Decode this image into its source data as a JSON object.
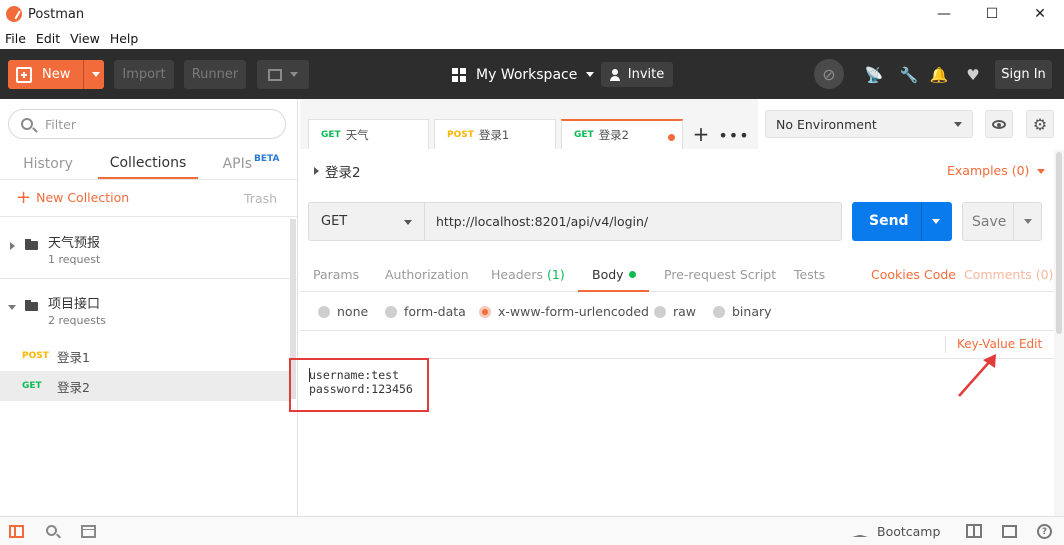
{
  "window": {
    "title": "Postman",
    "minimize_glyph": "—",
    "maximize_glyph": "☐",
    "close_glyph": "✕"
  },
  "menu": [
    "File",
    "Edit",
    "View",
    "Help"
  ],
  "header": {
    "new_label": "New",
    "import_label": "Import",
    "runner_label": "Runner",
    "workspace_label": "My Workspace",
    "invite_label": "Invite",
    "signin_label": "Sign In",
    "icons": [
      "sync-off-icon",
      "satellite-icon",
      "wrench-icon",
      "bell-icon",
      "heart-icon"
    ],
    "accent_color": "#f26b3a"
  },
  "sidebar": {
    "filter_placeholder": "Filter",
    "tabs": {
      "history": "History",
      "collections": "Collections",
      "apis": "APIs",
      "apis_badge": "BETA"
    },
    "new_collection_label": "New Collection",
    "trash_label": "Trash",
    "collections": [
      {
        "name": "天气预报",
        "count": "1 request",
        "expanded": false
      },
      {
        "name": "项目接口",
        "count": "2 requests",
        "expanded": true
      }
    ],
    "requests": [
      {
        "method": "POST",
        "name": "登录1"
      },
      {
        "method": "GET",
        "name": "登录2",
        "selected": true
      }
    ]
  },
  "request_tabs": [
    {
      "method": "GET",
      "name": "天气"
    },
    {
      "method": "POST",
      "name": "登录1"
    },
    {
      "method": "GET",
      "name": "登录2",
      "active": true,
      "unsaved": true
    }
  ],
  "environment": {
    "selected": "No Environment"
  },
  "request": {
    "name": "登录2",
    "examples_label": "Examples (0)",
    "method": "GET",
    "url": "http://localhost:8201/api/v4/login/",
    "send_label": "Send",
    "save_label": "Save",
    "subtabs": {
      "params": "Params",
      "authorization": "Authorization",
      "headers": "Headers",
      "headers_count": "(1)",
      "body": "Body",
      "prerequest": "Pre-request Script",
      "tests": "Tests"
    },
    "links": {
      "cookies": "Cookies",
      "code": "Code",
      "comments": "Comments (0)"
    },
    "body_modes": [
      "none",
      "form-data",
      "x-www-form-urlencoded",
      "raw",
      "binary"
    ],
    "body_mode_selected": "x-www-form-urlencoded",
    "kv_edit_label": "Key-Value Edit",
    "body_lines": [
      "username:test",
      "password:123456"
    ]
  },
  "statusbar": {
    "bootcamp_label": "Bootcamp",
    "help_glyph": "?"
  },
  "colors": {
    "get": "#0cbb52",
    "post": "#ffb400",
    "send": "#097bed",
    "annotation_red": "#e33a3a"
  }
}
